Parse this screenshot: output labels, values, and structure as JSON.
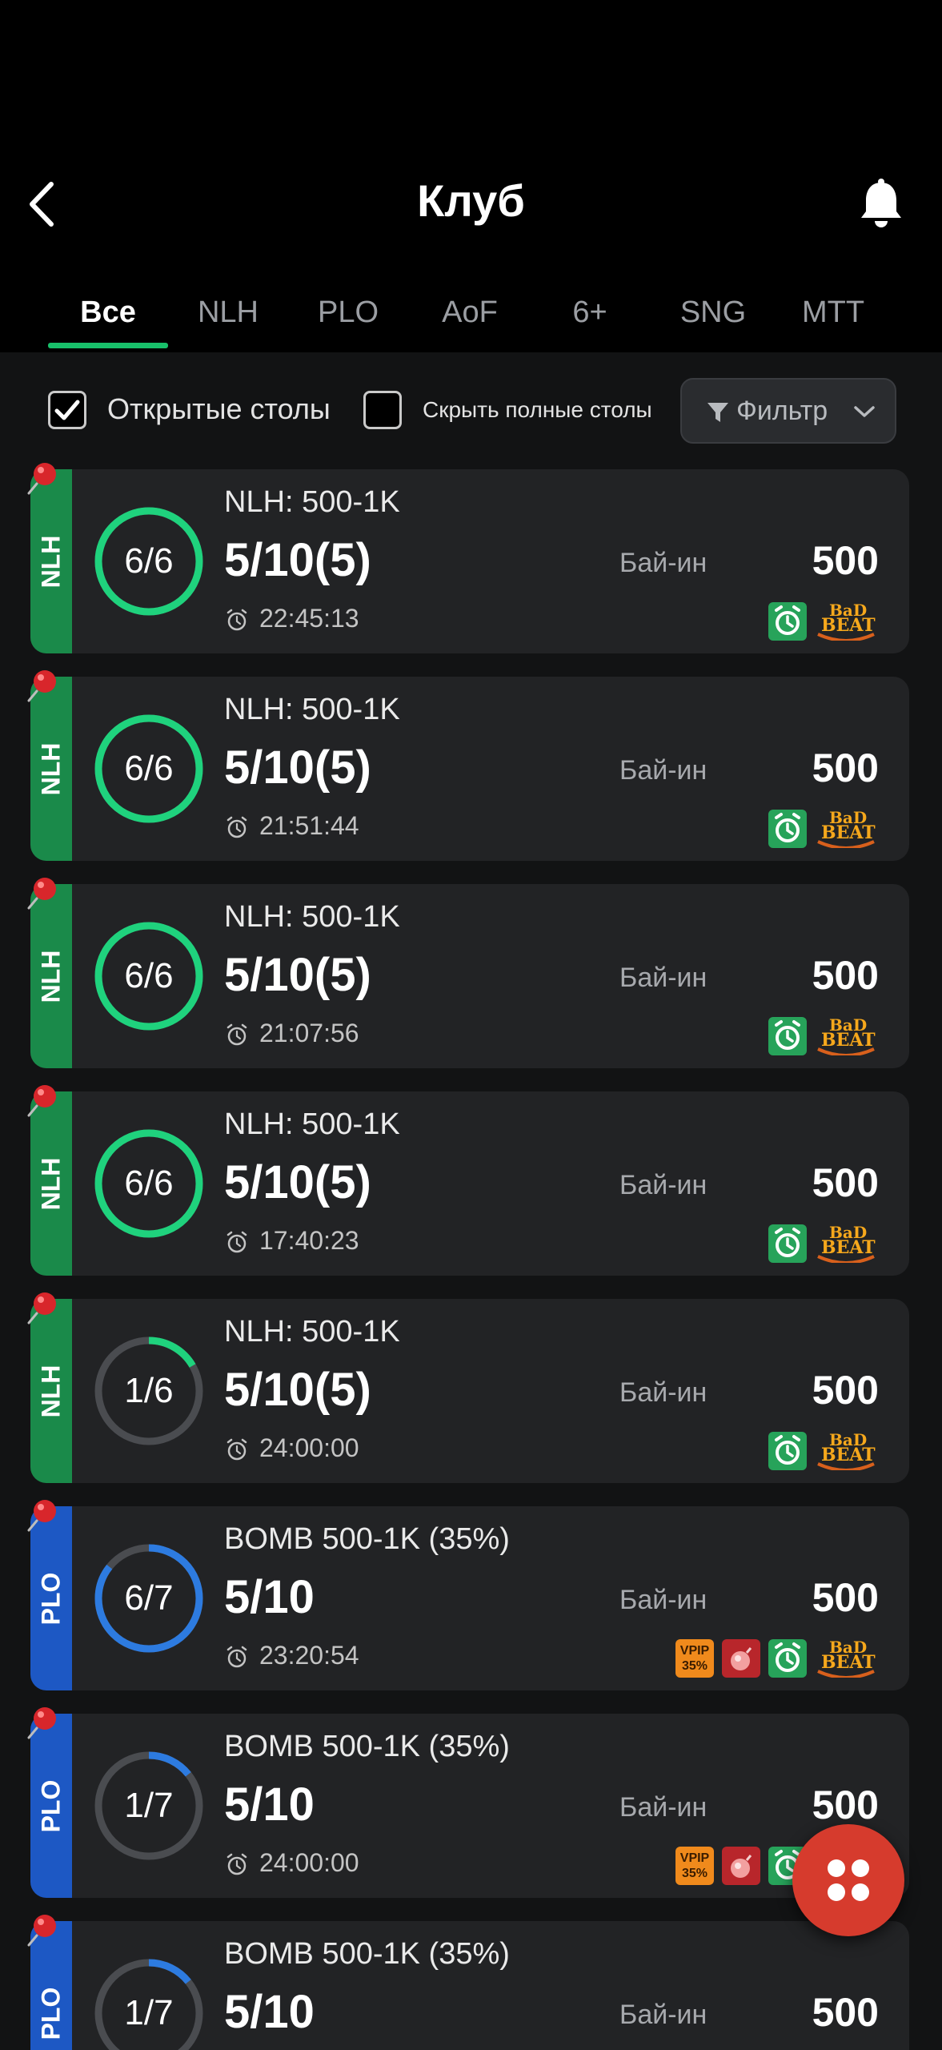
{
  "header": {
    "title": "Клуб",
    "tabs": [
      {
        "label": "Все",
        "active": true
      },
      {
        "label": "NLH",
        "active": false
      },
      {
        "label": "PLO",
        "active": false
      },
      {
        "label": "AoF",
        "active": false
      },
      {
        "label": "6+",
        "active": false
      },
      {
        "label": "SNG",
        "active": false
      },
      {
        "label": "MTT",
        "active": false
      }
    ]
  },
  "filters": {
    "open_tables": {
      "label": "Открытые столы",
      "checked": true
    },
    "hide_full": {
      "label": "Скрыть полные столы",
      "checked": false
    },
    "filter_button": "Фильтр"
  },
  "colors": {
    "accent": "#18c06a",
    "nlh": "#1a8a4a",
    "plo": "#1d58c4",
    "ring_nlh": "#1fd27d",
    "ring_plo": "#2d7be0",
    "ring_track": "#4a4c50"
  },
  "tables": [
    {
      "type": "NLH",
      "seats": "6/6",
      "fill": 1.0,
      "name": "NLH: 500-1K",
      "stakes": "5/10(5)",
      "timer": "22:45:13",
      "buyin_label": "Бай-ин",
      "buyin": "500",
      "badges": [
        "alarm",
        "badbeat"
      ]
    },
    {
      "type": "NLH",
      "seats": "6/6",
      "fill": 1.0,
      "name": "NLH: 500-1K",
      "stakes": "5/10(5)",
      "timer": "21:51:44",
      "buyin_label": "Бай-ин",
      "buyin": "500",
      "badges": [
        "alarm",
        "badbeat"
      ]
    },
    {
      "type": "NLH",
      "seats": "6/6",
      "fill": 1.0,
      "name": "NLH: 500-1K",
      "stakes": "5/10(5)",
      "timer": "21:07:56",
      "buyin_label": "Бай-ин",
      "buyin": "500",
      "badges": [
        "alarm",
        "badbeat"
      ]
    },
    {
      "type": "NLH",
      "seats": "6/6",
      "fill": 1.0,
      "name": "NLH: 500-1K",
      "stakes": "5/10(5)",
      "timer": "17:40:23",
      "buyin_label": "Бай-ин",
      "buyin": "500",
      "badges": [
        "alarm",
        "badbeat"
      ]
    },
    {
      "type": "NLH",
      "seats": "1/6",
      "fill": 0.1667,
      "name": "NLH: 500-1K",
      "stakes": "5/10(5)",
      "timer": "24:00:00",
      "buyin_label": "Бай-ин",
      "buyin": "500",
      "badges": [
        "alarm",
        "badbeat"
      ]
    },
    {
      "type": "PLO",
      "seats": "6/7",
      "fill": 0.857,
      "name": "BOMB 500-1K (35%)",
      "stakes": "5/10",
      "timer": "23:20:54",
      "buyin_label": "Бай-ин",
      "buyin": "500",
      "badges": [
        "vpip",
        "bomb",
        "alarm",
        "badbeat"
      ]
    },
    {
      "type": "PLO",
      "seats": "1/7",
      "fill": 0.1429,
      "name": "BOMB 500-1K (35%)",
      "stakes": "5/10",
      "timer": "24:00:00",
      "buyin_label": "Бай-ин",
      "buyin": "500",
      "badges": [
        "vpip",
        "bomb",
        "alarm",
        "badbeat"
      ]
    },
    {
      "type": "PLO",
      "seats": "1/7",
      "fill": 0.1429,
      "name": "BOMB 500-1K (35%)",
      "stakes": "5/10",
      "timer": "",
      "buyin_label": "Бай-ин",
      "buyin": "500",
      "badges": []
    }
  ],
  "badge_text": {
    "vpip_line1": "VPIP",
    "vpip_line2": "35%",
    "badbeat_line1": "BaD",
    "badbeat_line2": "BEAT"
  }
}
